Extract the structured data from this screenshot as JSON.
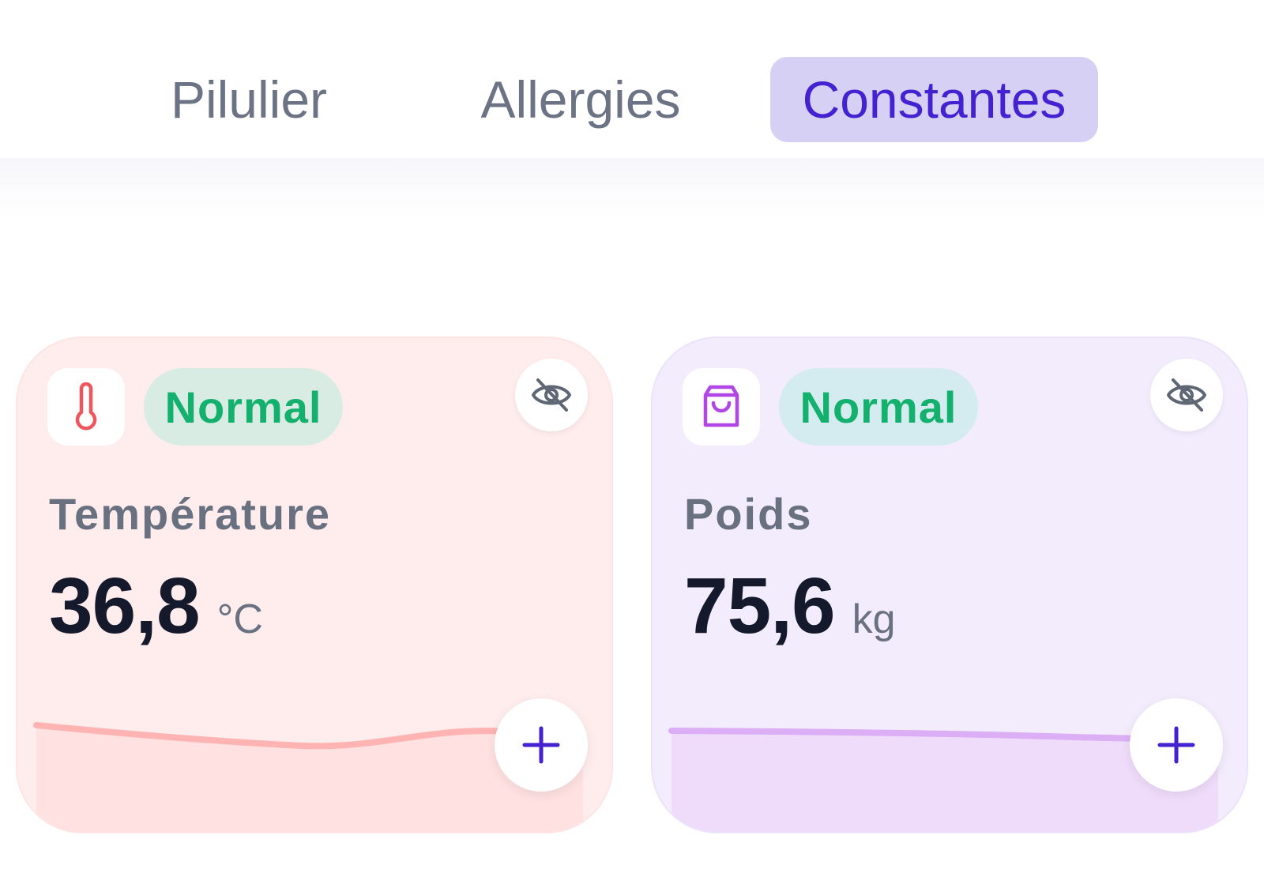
{
  "tabs": [
    {
      "label": "Pilulier",
      "active": false
    },
    {
      "label": "Allergies",
      "active": false
    },
    {
      "label": "Constantes",
      "active": true
    }
  ],
  "colors": {
    "accent": "#4422d2",
    "active_tab_bg": "#d6d0f5",
    "status_normal": "#13b06e",
    "temperature_line": "#ffb3b3",
    "weight_line": "#dcaef5"
  },
  "cards": [
    {
      "icon": "thermometer-icon",
      "status": "Normal",
      "title": "Température",
      "value": "36,8",
      "unit": "°C",
      "visibility_icon": "eye-off-icon",
      "action_icon": "plus-icon"
    },
    {
      "icon": "shopping-bag-icon",
      "status": "Normal",
      "title": "Poids",
      "value": "75,6",
      "unit": "kg",
      "visibility_icon": "eye-off-icon",
      "action_icon": "plus-icon"
    }
  ]
}
